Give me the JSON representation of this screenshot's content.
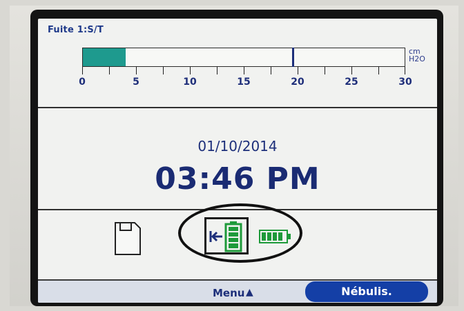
{
  "header": {
    "title": "Fuite 1:S/T"
  },
  "gauge": {
    "unit_line1": "cm",
    "unit_line2": "H2O",
    "ticks": [
      "0",
      "5",
      "10",
      "15",
      "20",
      "25",
      "30"
    ],
    "range": [
      0,
      30
    ],
    "fill_value": 4,
    "marker_value": 19.5,
    "fill_color": "#1e9a8e",
    "marker_color": "#1d2f7a"
  },
  "clock": {
    "date": "01/10/2014",
    "time": "03:46 PM"
  },
  "status_icons": {
    "save": "floppy-disk-icon",
    "mains": "plug-battery-charging-icon",
    "battery": "battery-full-icon"
  },
  "footer": {
    "menu_label": "Menu",
    "menu_arrow": "▲",
    "nebulis_label": "Nébulis."
  },
  "colors": {
    "accent": "#143fa6",
    "text": "#1d2f7a",
    "battery": "#1e9a3a"
  }
}
